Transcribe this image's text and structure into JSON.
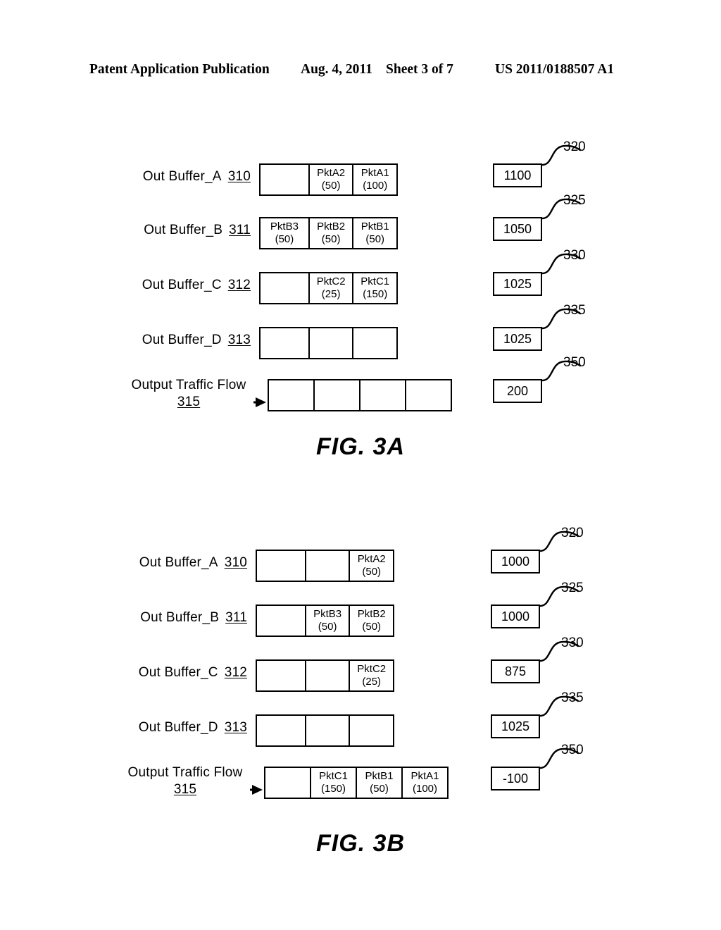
{
  "header": {
    "publication": "Patent Application Publication",
    "date": "Aug. 4, 2011",
    "sheet": "Sheet 3 of 7",
    "number": "US 2011/0188507 A1"
  },
  "figures": [
    {
      "caption": "FIG. 3A",
      "rows": [
        {
          "label": "Out Buffer_A",
          "ref": "310",
          "cells": [
            {
              "name": "",
              "size": ""
            },
            {
              "name": "PktA2",
              "size": "(50)"
            },
            {
              "name": "PktA1",
              "size": "(100)"
            }
          ],
          "value": "1100",
          "value_ref": "320"
        },
        {
          "label": "Out Buffer_B",
          "ref": "311",
          "cells": [
            {
              "name": "PktB3",
              "size": "(50)"
            },
            {
              "name": "PktB2",
              "size": "(50)"
            },
            {
              "name": "PktB1",
              "size": "(50)"
            }
          ],
          "value": "1050",
          "value_ref": "325"
        },
        {
          "label": "Out Buffer_C",
          "ref": "312",
          "cells": [
            {
              "name": "",
              "size": ""
            },
            {
              "name": "PktC2",
              "size": "(25)"
            },
            {
              "name": "PktC1",
              "size": "(150)"
            }
          ],
          "value": "1025",
          "value_ref": "330"
        },
        {
          "label": "Out Buffer_D",
          "ref": "313",
          "cells": [
            {
              "name": "",
              "size": ""
            },
            {
              "name": "",
              "size": ""
            },
            {
              "name": "",
              "size": ""
            }
          ],
          "value": "1025",
          "value_ref": "335"
        },
        {
          "label": "Output Traffic Flow",
          "ref": "315",
          "cells": [
            {
              "name": "",
              "size": ""
            },
            {
              "name": "",
              "size": ""
            },
            {
              "name": "",
              "size": ""
            },
            {
              "name": "",
              "size": ""
            }
          ],
          "value": "200",
          "value_ref": "350"
        }
      ]
    },
    {
      "caption": "FIG. 3B",
      "rows": [
        {
          "label": "Out Buffer_A",
          "ref": "310",
          "cells": [
            {
              "name": "",
              "size": ""
            },
            {
              "name": "",
              "size": ""
            },
            {
              "name": "PktA2",
              "size": "(50)"
            }
          ],
          "value": "1000",
          "value_ref": "320"
        },
        {
          "label": "Out Buffer_B",
          "ref": "311",
          "cells": [
            {
              "name": "",
              "size": ""
            },
            {
              "name": "PktB3",
              "size": "(50)"
            },
            {
              "name": "PktB2",
              "size": "(50)"
            }
          ],
          "value": "1000",
          "value_ref": "325"
        },
        {
          "label": "Out Buffer_C",
          "ref": "312",
          "cells": [
            {
              "name": "",
              "size": ""
            },
            {
              "name": "",
              "size": ""
            },
            {
              "name": "PktC2",
              "size": "(25)"
            }
          ],
          "value": "875",
          "value_ref": "330"
        },
        {
          "label": "Out Buffer_D",
          "ref": "313",
          "cells": [
            {
              "name": "",
              "size": ""
            },
            {
              "name": "",
              "size": ""
            },
            {
              "name": "",
              "size": ""
            }
          ],
          "value": "1025",
          "value_ref": "335"
        },
        {
          "label": "Output Traffic Flow",
          "ref": "315",
          "cells": [
            {
              "name": "",
              "size": ""
            },
            {
              "name": "PktC1",
              "size": "(150)"
            },
            {
              "name": "PktB1",
              "size": "(50)"
            },
            {
              "name": "PktA1",
              "size": "(100)"
            }
          ],
          "value": "-100",
          "value_ref": "350"
        }
      ]
    }
  ]
}
